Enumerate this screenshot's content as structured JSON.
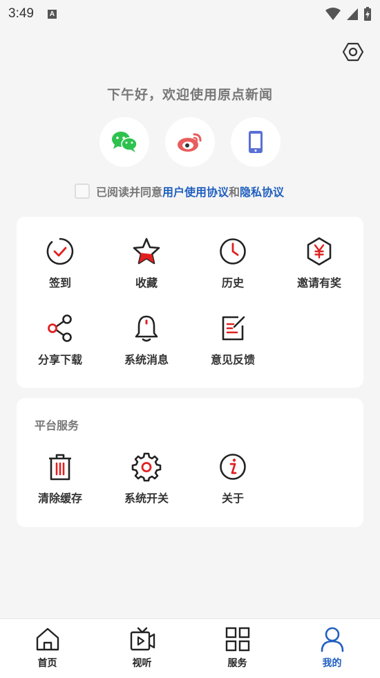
{
  "status_bar": {
    "time": "3:49",
    "notification_letter": "A"
  },
  "greeting": "下午好，欢迎使用原点新闻",
  "login": {
    "options": [
      {
        "icon": "wechat-icon"
      },
      {
        "icon": "weibo-icon"
      },
      {
        "icon": "phone-icon"
      }
    ]
  },
  "agreement": {
    "prefix": "已阅读并同意",
    "user_agreement": "用户使用协议",
    "conjunction": "和",
    "privacy": "隐私协议"
  },
  "features": [
    {
      "label": "签到",
      "icon": "checkin-icon"
    },
    {
      "label": "收藏",
      "icon": "star-icon"
    },
    {
      "label": "历史",
      "icon": "clock-icon"
    },
    {
      "label": "邀请有奖",
      "icon": "yuan-icon"
    },
    {
      "label": "分享下载",
      "icon": "share-icon"
    },
    {
      "label": "系统消息",
      "icon": "bell-icon"
    },
    {
      "label": "意见反馈",
      "icon": "feedback-icon"
    }
  ],
  "platform": {
    "title": "平台服务",
    "items": [
      {
        "label": "清除缓存",
        "icon": "trash-icon"
      },
      {
        "label": "系统开关",
        "icon": "gear-icon"
      },
      {
        "label": "关于",
        "icon": "info-icon"
      }
    ]
  },
  "tabs": [
    {
      "label": "首页",
      "icon": "home-icon"
    },
    {
      "label": "视听",
      "icon": "tv-icon"
    },
    {
      "label": "服务",
      "icon": "grid-icon"
    },
    {
      "label": "我的",
      "icon": "user-icon",
      "active": true
    }
  ],
  "colors": {
    "accent": "#1f5fbf",
    "red": "#e02020",
    "wechat": "#2dc24e",
    "weibo": "#e85d5d",
    "phone": "#5a6fd6"
  }
}
